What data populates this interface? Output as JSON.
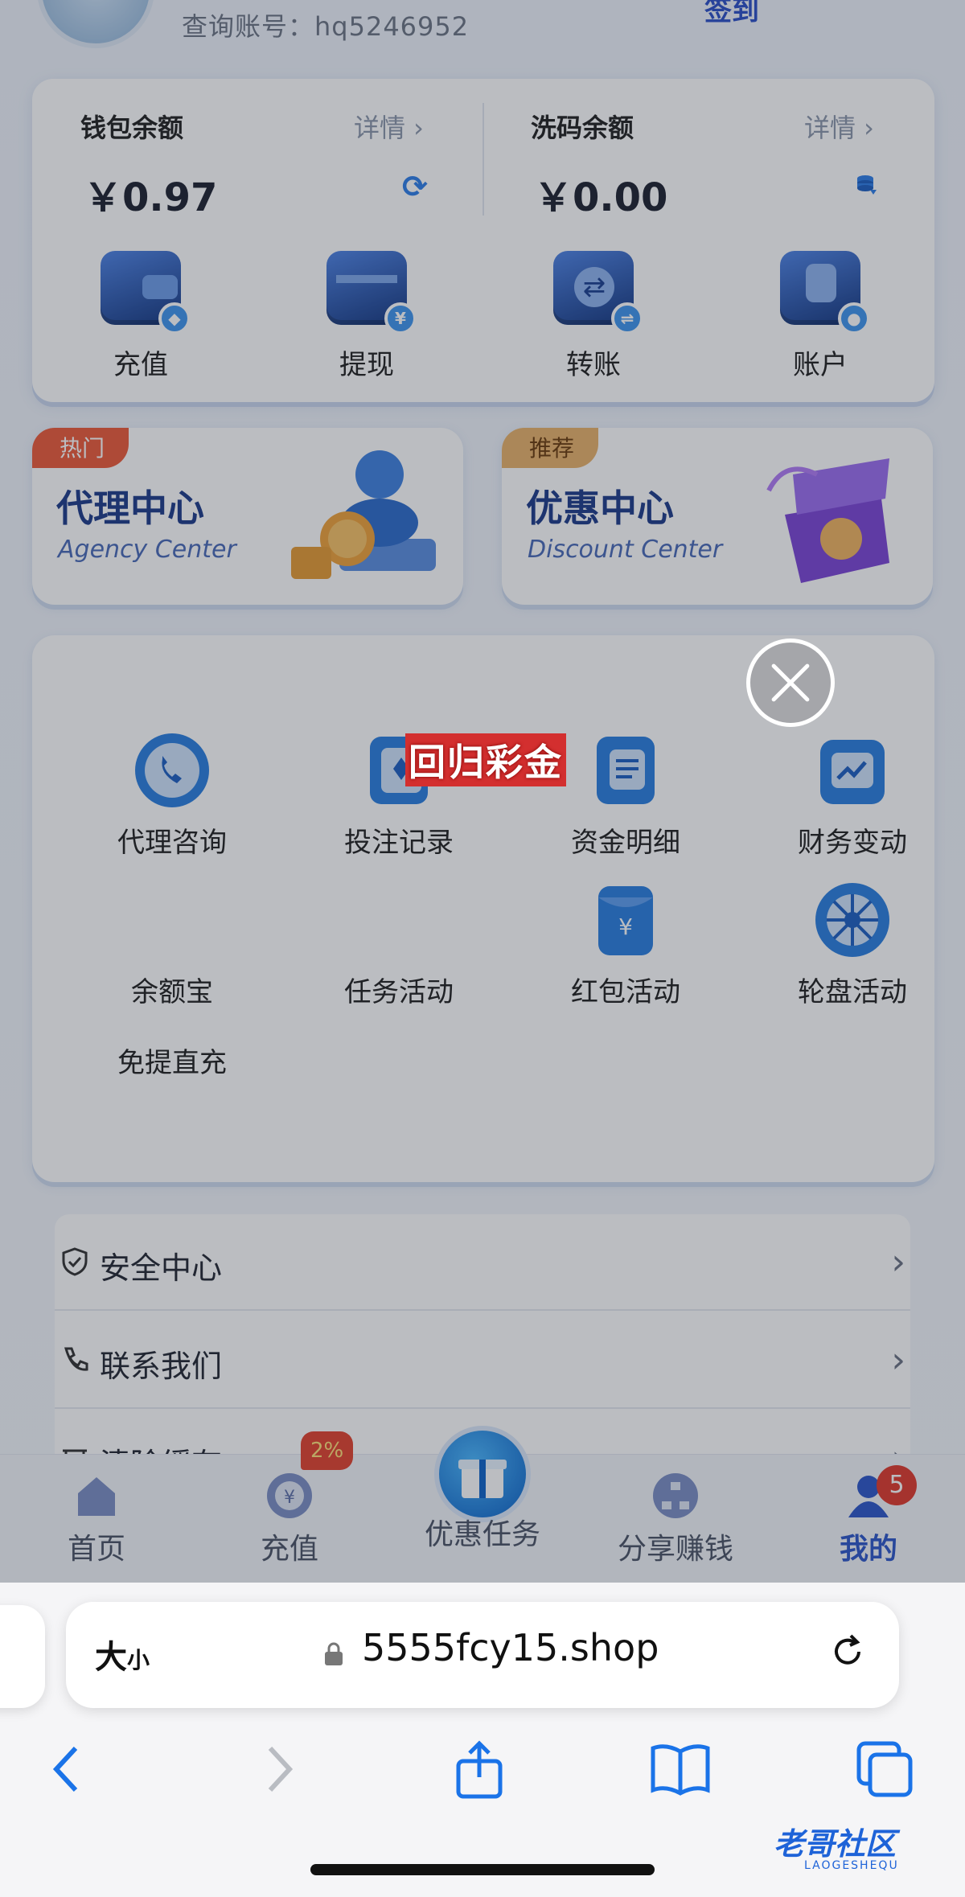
{
  "header": {
    "account_label": "查询账号：hq5246952",
    "signin_label": "签到"
  },
  "wallet": {
    "left": {
      "title": "钱包余额",
      "detail": "详情 ›",
      "amount": "￥0.97"
    },
    "right": {
      "title": "洗码余额",
      "detail": "详情 ›",
      "amount": "￥0.00"
    },
    "actions": [
      {
        "label": "充值",
        "icon": "wallet-icon"
      },
      {
        "label": "提现",
        "icon": "card-withdraw-icon"
      },
      {
        "label": "转账",
        "icon": "transfer-icon"
      },
      {
        "label": "账户",
        "icon": "account-icon"
      }
    ]
  },
  "promos": [
    {
      "tag": "热门",
      "title": "代理中心",
      "subtitle": "Agency Center",
      "tag_color": "#ec5b3a"
    },
    {
      "tag": "推荐",
      "title": "优惠中心",
      "subtitle": "Discount Center",
      "tag_color": "#e8b26b"
    }
  ],
  "grid": {
    "items": [
      {
        "label": "代理咨询",
        "icon": "phone-icon"
      },
      {
        "label": "投注记录",
        "icon": "bet-record-icon"
      },
      {
        "label": "资金明细",
        "icon": "fund-detail-icon"
      },
      {
        "label": "财务变动",
        "icon": "finance-chart-icon"
      },
      {
        "label": "余额宝",
        "icon": ""
      },
      {
        "label": "任务活动",
        "icon": ""
      },
      {
        "label": "红包活动",
        "icon": "red-envelope-icon"
      },
      {
        "label": "轮盘活动",
        "icon": "roulette-icon"
      },
      {
        "label": "免提直充",
        "icon": ""
      }
    ]
  },
  "list": [
    {
      "label": "安全中心",
      "icon": "shield-icon"
    },
    {
      "label": "联系我们",
      "icon": "phone-outline-icon"
    },
    {
      "label": "清除缓存",
      "icon": "trash-icon"
    }
  ],
  "tabbar": {
    "items": [
      {
        "label": "首页",
        "icon": "home-icon"
      },
      {
        "label": "充值",
        "icon": "deposit-icon"
      },
      {
        "label": "优惠任务",
        "icon": "gift-icon"
      },
      {
        "label": "分享赚钱",
        "icon": "share-network-icon"
      },
      {
        "label": "我的",
        "icon": "user-icon"
      }
    ],
    "deposit_badge": "2%",
    "profile_badge": "5"
  },
  "popup": {
    "title": "回归彩金"
  },
  "browser": {
    "text_size_label": "大",
    "text_size_small": "小",
    "url": "5555fcy15.shop"
  },
  "watermark": {
    "text": "老哥社区",
    "sub": "LAOGESHEQU"
  },
  "colors": {
    "brand_blue": "#2d57c9",
    "badge_red": "#e03a2d",
    "popup_red": "#d32f2f"
  }
}
